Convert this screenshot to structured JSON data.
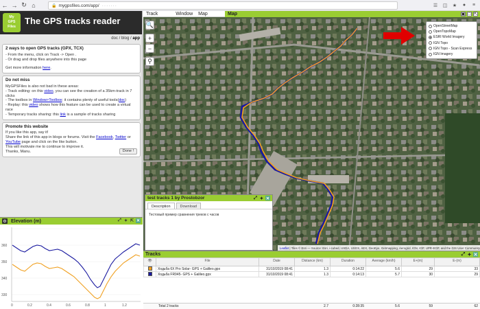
{
  "browser": {
    "url": "mygpsfiles.com/app/"
  },
  "header": {
    "logo_text": "My GPS Files",
    "title": "The GPS tracks reader",
    "links": [
      "doc",
      "blog",
      "app"
    ]
  },
  "info": {
    "open": {
      "title": "2 ways to open GPS tracks (GPX, TCX)",
      "line1": "- From the menu, click on Track -> Open .",
      "line2": "- Or drag and drop files anywhere into this page",
      "more": "Get more information",
      "here": "here"
    },
    "miss": {
      "title": "Do not miss",
      "intro": "MyGPSFiles is also not bad in these areas:",
      "l1a": "- Track editing: on this",
      "l1link": "video",
      "l1b": ", you can see the creation of a 35km-track in 7 clicks",
      "l2a": "- The toolbox in",
      "l2link": "Window>Toolbox",
      "l2b": ": it contains plenty of useful tools(",
      "l2link2": "doc",
      "l2c": ")",
      "l3a": "- Replay: this",
      "l3link": "video",
      "l3b": "shows how this feature can be used to create a virtual race",
      "l4a": "- Temporary tracks sharing: this",
      "l4link": "link",
      "l4b": "is a sample of tracks sharing"
    },
    "promote": {
      "title": "Promote this website",
      "l1": "If you like this app, say it!",
      "l2a": "Share the link of this app in blogs or forums. Visit the",
      "facebook": "Facebook",
      "twitter": "Twitter",
      "or": "or",
      "youtube": "YouTube",
      "l2b": "page and click on the like button.",
      "l3": "This will motivate me to continue to improve it.",
      "thanks": "Thanks, Manu.",
      "done": "Done !"
    }
  },
  "elevation": {
    "title": "Elevation (m)",
    "yticks": [
      "360",
      "350",
      "340",
      "330"
    ],
    "xticks": [
      "0",
      "0.2",
      "0.4",
      "0.6",
      "0.8",
      "1",
      "1.2"
    ]
  },
  "menu": [
    "Track",
    "Window",
    "Map"
  ],
  "map": {
    "tab_title": "Map",
    "layers": [
      "OpenStreetMap",
      "OpenTopoMap",
      "ESRI World Imagery",
      "IGN Topo",
      "IGN Topo - Scan Express",
      "IGN Imagery"
    ],
    "selected_layer": "ESRI World Imagery",
    "attribution_lead": "Leaflet",
    "attribution_rest": "| Tiles © Esri — Source: Esri, i-cubed, USDA, USGS, AEX, GeoEye, Getmapping, Aerogrid, IGN, IGP, UPR-EGP, and the GIS User Community"
  },
  "popup": {
    "title": "test tracks 1 by Prostobzor",
    "tabs": [
      "Description",
      "Download"
    ],
    "text": "Тестовый пример сравнения треков с часов"
  },
  "tracks": {
    "title": "Tracks",
    "columns": [
      "",
      "File",
      "Date",
      "Distance (km)",
      "Duration",
      "Average (km/h)",
      "E+(m)",
      "E-(m)"
    ],
    "rows": [
      {
        "file": "Ходьба 6X Pro Solar- GPS + Galileo.gpx",
        "date": "31/10/2019 08:41",
        "distance": "1.3",
        "duration": "0:14:22",
        "average": "5.6",
        "eplus": "29",
        "eminus": "33",
        "color": "#f0a020"
      },
      {
        "file": "Ходьба FR945- GPS + Galileo.gpx",
        "date": "31/10/2019 08:41",
        "distance": "1.3",
        "duration": "0:14:13",
        "average": "5.7",
        "eplus": "30",
        "eminus": "29",
        "color": "#1a1aa0"
      }
    ],
    "total_label": "Total 2 tracks",
    "total": {
      "distance": "2.7",
      "duration": "0:28:35",
      "average": "5.6",
      "eplus": "59",
      "eminus": "62"
    }
  },
  "colors": {
    "accent": "#9acd32",
    "header": "#2b2b2b",
    "track_orange": "#f0a020",
    "track_blue": "#1a1aa0"
  }
}
